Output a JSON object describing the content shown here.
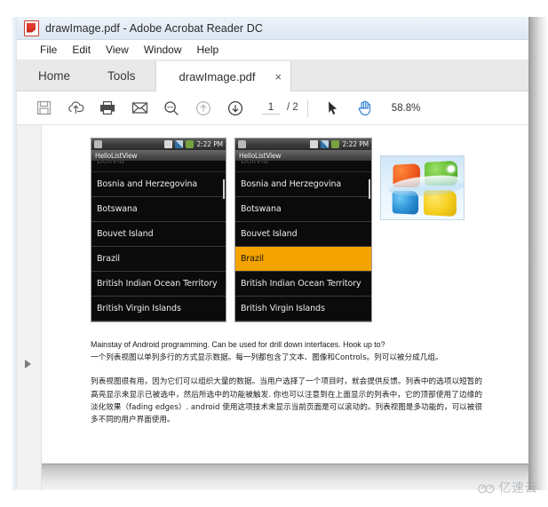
{
  "window": {
    "title": "drawImage.pdf - Adobe Acrobat Reader DC",
    "app_icon": "acrobat-pdf-icon"
  },
  "menu": {
    "items": [
      {
        "label": "File"
      },
      {
        "label": "Edit"
      },
      {
        "label": "View"
      },
      {
        "label": "Window"
      },
      {
        "label": "Help"
      }
    ]
  },
  "tabs": {
    "home_label": "Home",
    "tools_label": "Tools",
    "document_label": "drawImage.pdf",
    "close_label": "×"
  },
  "toolbar": {
    "icons": [
      {
        "name": "save-icon"
      },
      {
        "name": "upload-cloud-icon"
      },
      {
        "name": "print-icon"
      },
      {
        "name": "email-icon"
      },
      {
        "name": "zoom-icon"
      },
      {
        "name": "previous-page-icon"
      },
      {
        "name": "next-page-icon"
      },
      {
        "name": "select-tool-icon"
      },
      {
        "name": "hand-tool-icon"
      }
    ],
    "page_current": "1",
    "page_total": "/ 2",
    "zoom_level": "58.8%"
  },
  "sidebar": {
    "expand_icon": "expand-arrow-icon"
  },
  "document": {
    "screenshot_left": {
      "status_clock": "2:22 PM",
      "app_title": "HelloListView",
      "rows": [
        {
          "label": "Bolivia",
          "selected": false,
          "faded": true
        },
        {
          "label": "Bosnia and Herzegovina",
          "selected": false,
          "faded": false
        },
        {
          "label": "Botswana",
          "selected": false,
          "faded": false
        },
        {
          "label": "Bouvet Island",
          "selected": false,
          "faded": false
        },
        {
          "label": "Brazil",
          "selected": false,
          "faded": false
        },
        {
          "label": "British Indian Ocean Territory",
          "selected": false,
          "faded": false
        },
        {
          "label": "British Virgin Islands",
          "selected": false,
          "faded": false
        }
      ]
    },
    "screenshot_right": {
      "status_clock": "2:22 PM",
      "app_title": "HelloListView",
      "selected_color": "#f5a300",
      "rows": [
        {
          "label": "Bolivia",
          "selected": false,
          "faded": true
        },
        {
          "label": "Bosnia and Herzegovina",
          "selected": false,
          "faded": false
        },
        {
          "label": "Botswana",
          "selected": false,
          "faded": false
        },
        {
          "label": "Bouvet Island",
          "selected": false,
          "faded": false
        },
        {
          "label": "Brazil",
          "selected": true,
          "faded": false
        },
        {
          "label": "British Indian Ocean Territory",
          "selected": false,
          "faded": false
        },
        {
          "label": "British Virgin Islands",
          "selected": false,
          "faded": false
        }
      ]
    },
    "windows_logo": {
      "name": "windows-logo-image"
    },
    "paragraphs": [
      "Mainstay of Android programming. Can be used for drill down interfaces. Hook up to?",
      "一个列表视图以单列多行的方式显示数据。每一列都包含了文本、图像和Controls。列可以被分成几组。",
      "列表视图很有用，因为它们可以组织大量的数据。当用户选择了一个项目时，就会提供反馈。列表中的选项以短暂的高亮显示来显示已被选中，然后所选中的功能被触发. 你也可以注意到在上面显示的列表中，它的顶部使用了边缘的淡化效果（fading edges）. android 使用这项技术来显示当前页面是可以滚动的。列表视图是多功能的，可以被很多不同的用户界面使用。"
    ]
  },
  "watermark": {
    "text": "亿速云",
    "icon": "cloud-icon"
  }
}
